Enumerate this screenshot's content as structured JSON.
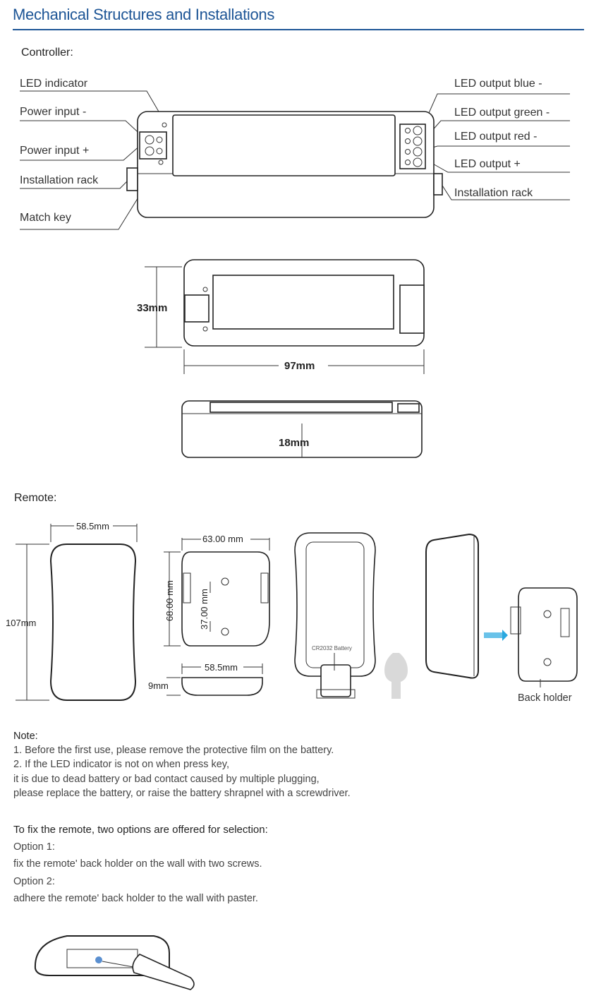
{
  "title": "Mechanical Structures and Installations",
  "controller": {
    "heading": "Controller:",
    "labels_left": [
      "LED indicator",
      "Power input -",
      "Power input +",
      "Installation rack",
      "Match key"
    ],
    "labels_right": [
      "LED output blue -",
      "LED output green -",
      "LED output red -",
      "LED output +",
      "Installation rack"
    ],
    "dim_height": "33mm",
    "dim_length": "97mm",
    "dim_depth": "18mm"
  },
  "remote": {
    "heading": "Remote:",
    "front_width": "58.5mm",
    "front_height": "107mm",
    "holder_width": "63.00 mm",
    "holder_height": "68.00 mm",
    "screw_spacing": "37.00 mm",
    "side_width": "58.5mm",
    "side_thickness": "9mm",
    "battery_label": "CR2032 Battery",
    "back_holder_label": "Back holder",
    "arrow_color": "#29a8e0"
  },
  "note": {
    "heading": "Note:",
    "lines": [
      "1. Before the first use, please remove the protective film on the battery.",
      "2. If the LED indicator is not on when press key,",
      "it is due to dead battery or bad contact caused by multiple plugging,",
      "please replace the battery, or raise the battery shrapnel with a screwdriver."
    ]
  },
  "fix": {
    "heading": "To fix the remote, two options are offered for selection:",
    "option1_label": "Option 1:",
    "option1_text": "fix the remote' back holder on the wall with two screws.",
    "option2_label": "Option 2:",
    "option2_text": "adhere the remote' back holder to the wall with paster."
  }
}
